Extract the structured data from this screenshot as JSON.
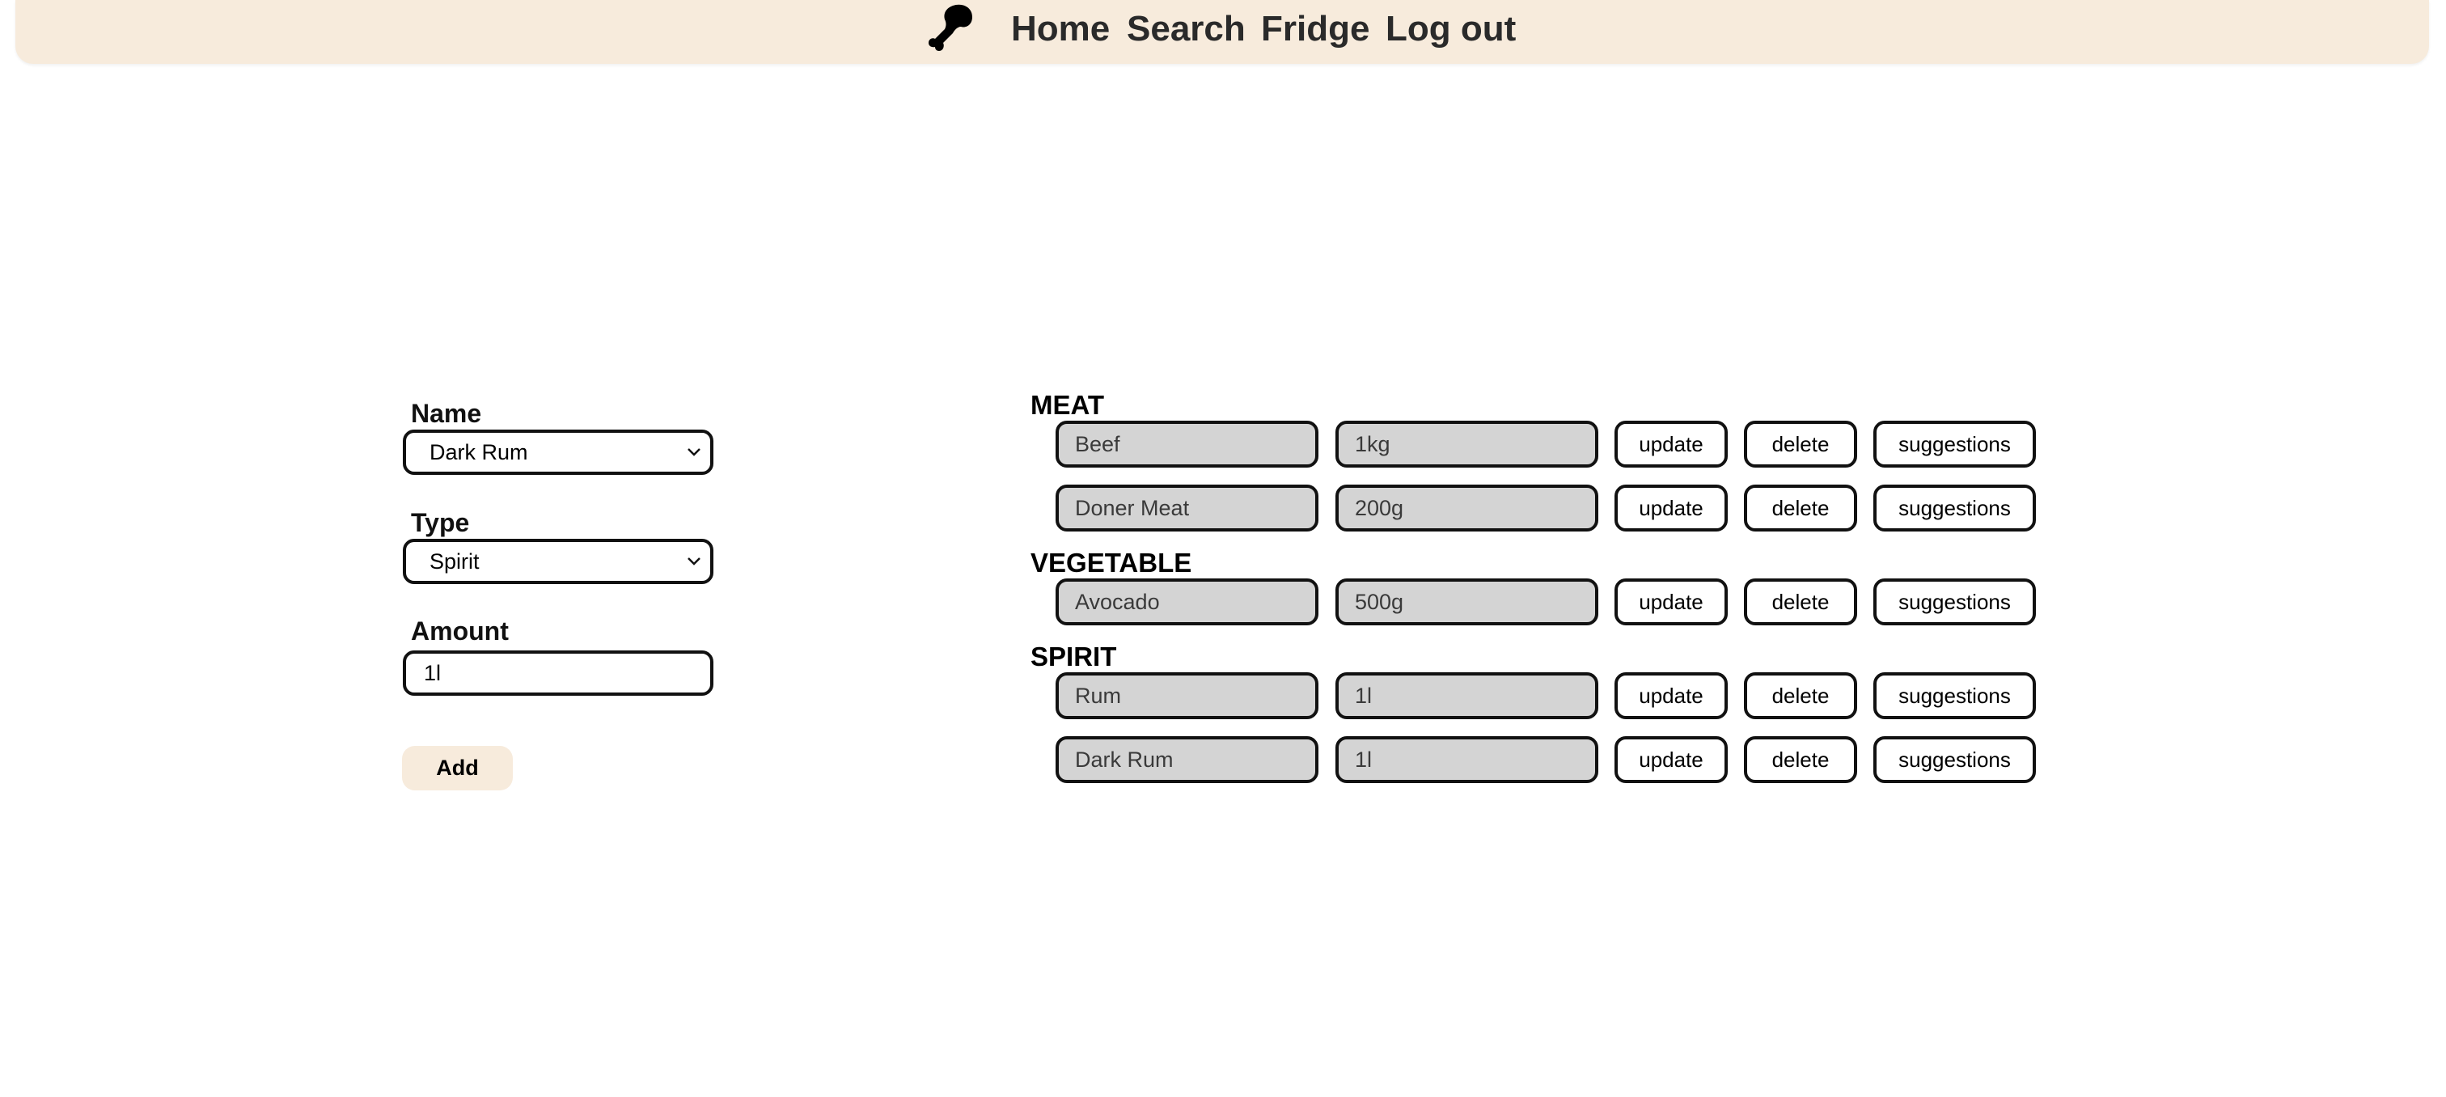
{
  "nav": {
    "logo_icon": "chicken-leg-icon",
    "links": [
      "Home",
      "Search",
      "Fridge",
      "Log out"
    ]
  },
  "form": {
    "name_label": "Name",
    "name_value": "Dark Rum",
    "type_label": "Type",
    "type_value": "Spirit",
    "amount_label": "Amount",
    "amount_value": "1l",
    "add_label": "Add"
  },
  "fridge": {
    "categories": [
      {
        "heading": "MEAT",
        "items": [
          {
            "name": "Beef",
            "amount": "1kg"
          },
          {
            "name": "Doner Meat",
            "amount": "200g"
          }
        ]
      },
      {
        "heading": "VEGETABLE",
        "items": [
          {
            "name": "Avocado",
            "amount": "500g"
          }
        ]
      },
      {
        "heading": "SPIRIT",
        "items": [
          {
            "name": "Rum",
            "amount": "1l"
          },
          {
            "name": "Dark Rum",
            "amount": "1l"
          }
        ]
      }
    ],
    "update_label": "update",
    "delete_label": "delete",
    "suggestions_label": "suggestions"
  },
  "colors": {
    "navbar_bg": "#f7ebdc",
    "item_field_bg": "#d4d4d4",
    "add_button_bg": "#f7ebdc"
  }
}
